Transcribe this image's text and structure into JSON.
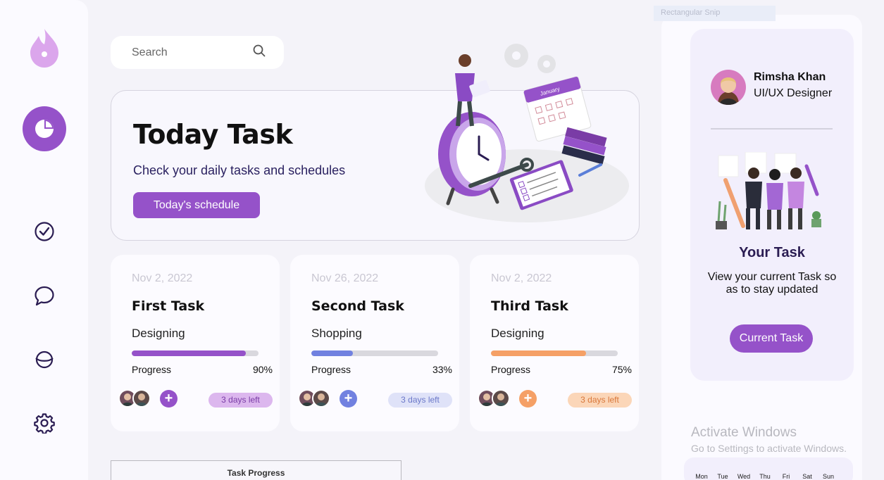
{
  "sidebar": {
    "icons": [
      "flame-logo-icon",
      "pie-chart-icon",
      "check-circle-icon",
      "chat-icon",
      "planet-icon",
      "gear-icon"
    ]
  },
  "search": {
    "placeholder": "Search"
  },
  "hero": {
    "title": "Today Task",
    "subtitle": "Check your daily tasks and schedules",
    "button_label": "Today's schedule"
  },
  "tasks": [
    {
      "date": "Nov 2, 2022",
      "title": "First Task",
      "category": "Designing",
      "progress_label": "Progress",
      "progress_text": "90%",
      "progress": 0.9,
      "days_left": "3 days left",
      "color": "#9552c9",
      "badge_bg": "#dcb7ee",
      "badge_fg": "#7a3ca6"
    },
    {
      "date": "Nov 26, 2022",
      "title": "Second Task",
      "category": "Shopping",
      "progress_label": "Progress",
      "progress_text": "33%",
      "progress": 0.33,
      "days_left": "3 days left",
      "color": "#7181e0",
      "badge_bg": "#dfe2f8",
      "badge_fg": "#6b78c9"
    },
    {
      "date": "Nov 2, 2022",
      "title": "Third Task",
      "category": "Designing",
      "progress_label": "Progress",
      "progress_text": "75%",
      "progress": 0.75,
      "days_left": "3 days left",
      "color": "#f5a066",
      "badge_bg": "#fbd6b8",
      "badge_fg": "#d9773a"
    }
  ],
  "task_progress": {
    "title": "Task Progress"
  },
  "profile": {
    "name": "Rimsha Khan",
    "role": "UI/UX Designer"
  },
  "your_task": {
    "title": "Your Task",
    "description": "View your current Task so as to stay updated",
    "button_label": "Current Task"
  },
  "overlay": {
    "snip_label": "Rectangular Snip",
    "activate_title": "Activate Windows",
    "activate_sub": "Go to Settings to activate Windows."
  },
  "calendar": {
    "days": [
      "Mon",
      "Tue",
      "Wed",
      "Thu",
      "Fri",
      "Sat",
      "Sun"
    ]
  },
  "colors": {
    "accent": "#9552c9",
    "sidebar_icon": "#2a1c52"
  }
}
